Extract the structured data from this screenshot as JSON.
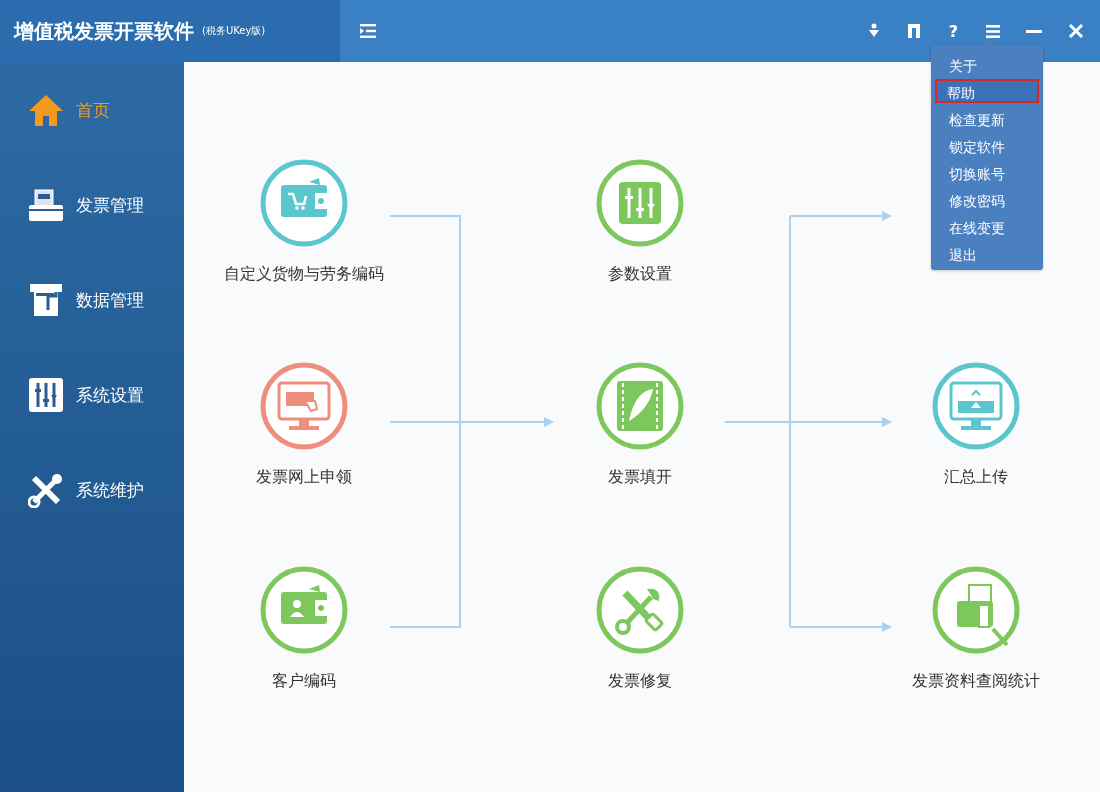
{
  "window": {
    "title": "增值税发票开票软件",
    "subtitle": "(税务UKey版)",
    "help_label": "?"
  },
  "sidebar": {
    "items": [
      {
        "label": "首页",
        "selected": true
      },
      {
        "label": "发票管理",
        "selected": false
      },
      {
        "label": "数据管理",
        "selected": false
      },
      {
        "label": "系统设置",
        "selected": false
      },
      {
        "label": "系统维护",
        "selected": false
      }
    ]
  },
  "flow": {
    "nodes": [
      {
        "label": "自定义货物与劳务编码"
      },
      {
        "label": "发票网上申领"
      },
      {
        "label": "客户编码"
      },
      {
        "label": "参数设置"
      },
      {
        "label": "发票填开"
      },
      {
        "label": "发票修复"
      },
      {
        "label": "汇总上传"
      },
      {
        "label": "发票资料查阅统计"
      }
    ]
  },
  "menu": {
    "items": [
      {
        "label": "关于",
        "selected": false
      },
      {
        "label": "帮助",
        "selected": true
      },
      {
        "label": "检查更新",
        "selected": false
      },
      {
        "label": "锁定软件",
        "selected": false
      },
      {
        "label": "切换账号",
        "selected": false
      },
      {
        "label": "修改密码",
        "selected": false
      },
      {
        "label": "在线变更",
        "selected": false
      },
      {
        "label": "退出",
        "selected": false
      }
    ]
  }
}
